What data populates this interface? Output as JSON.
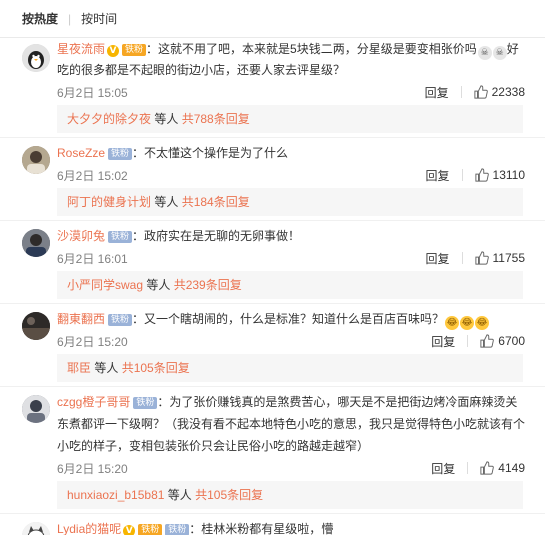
{
  "sort": {
    "hot": "按热度",
    "time": "按时间"
  },
  "comments": [
    {
      "name": "星夜流雨",
      "verified": true,
      "badges": [
        "vip"
      ],
      "text": "：这就不用了吧，本来就是5块钱二两，分星级是要变相张价吗",
      "text2": "好吃的很多都是不起眼的街边小店，还要人家去评星级？",
      "emoji": [
        "skull",
        "skull"
      ],
      "date": "6月2日 15:05",
      "reply": "回复",
      "likes": "22338",
      "sub": {
        "who": "大夕夕的除夕夜",
        "mid": " 等人 ",
        "total": "共788条回复"
      },
      "avatar_color": "#c9c9c9"
    },
    {
      "name": "RoseZze",
      "badges": [
        "fan"
      ],
      "text": "：不太懂这个操作是为了什么",
      "date": "6月2日 15:02",
      "reply": "回复",
      "likes": "13110",
      "sub": {
        "who": "阿丁的健身计划",
        "mid": " 等人 ",
        "total": "共184条回复"
      },
      "avatar_color": "#8a7b6a"
    },
    {
      "name": "沙漠卯兔",
      "badges": [
        "fan"
      ],
      "text": "：政府实在是无聊的无卵事做！",
      "date": "6月2日 16:01",
      "reply": "回复",
      "likes": "11755",
      "sub": {
        "who": "小严同学swag",
        "mid": " 等人 ",
        "total": "共239条回复"
      },
      "avatar_color": "#5a5e66"
    },
    {
      "name": "翻東翻西",
      "badges": [
        "fan"
      ],
      "text": "：又一个瞎胡闹的，什么是标准？知道什么是百店百味吗？",
      "emoji": [
        "laugh",
        "laugh",
        "laugh"
      ],
      "date": "6月2日 15:20",
      "reply": "回复",
      "likes": "6700",
      "sub": {
        "who": "耶臣",
        "mid": " 等人 ",
        "total": "共105条回复"
      },
      "avatar_color": "#3f3a35"
    },
    {
      "name": "czgg橙子哥哥",
      "badges": [
        "fan"
      ],
      "text": "：为了张价赚钱真的是煞费苦心，哪天是不是把街边烤冷面麻辣烫关东煮都评一下级啊？（我没有看不起本地特色小吃的意思，我只是觉得特色小吃就该有个小吃的样子，变相包装张价只会让民俗小吃的路越走越窄）",
      "date": "6月2日 15:20",
      "reply": "回复",
      "likes": "4149",
      "sub": {
        "who": "hunxiaozi_b15b81",
        "mid": " 等人 ",
        "total": "共105条回复"
      },
      "avatar_color": "#6c6f78"
    },
    {
      "name": "Lydia的猫呢",
      "verified": true,
      "badges": [
        "vip"
      ],
      "text": "：桂林米粉都有星级啦，懵",
      "avatar_color": "#d6d6d6"
    }
  ],
  "badge_labels": {
    "fan": "铁粉",
    "vip": "铁粉"
  },
  "icons": {
    "like": "thumbs-up-icon",
    "verified": "verified-v-icon"
  },
  "colors": {
    "username": "#eb7350",
    "link": "#eb7350",
    "meta": "#808080",
    "sub_bg": "#f6f6f6"
  }
}
